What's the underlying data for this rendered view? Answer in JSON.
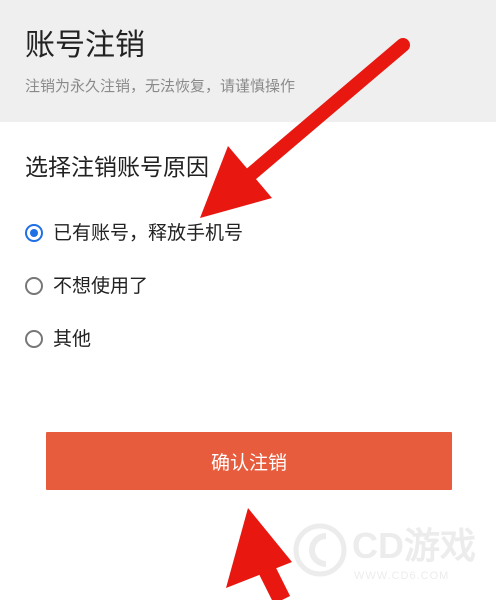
{
  "header": {
    "title": "账号注销",
    "subtitle": "注销为永久注销，无法恢复，请谨慎操作"
  },
  "form": {
    "section_title": "选择注销账号原因",
    "selected_index": 0,
    "options": [
      {
        "label": "已有账号，释放手机号",
        "checked": true
      },
      {
        "label": "不想使用了",
        "checked": false
      },
      {
        "label": "其他",
        "checked": false
      }
    ]
  },
  "actions": {
    "confirm_label": "确认注销"
  },
  "watermark": {
    "brand": "CD游戏",
    "url": "WWW.CD6.COM"
  },
  "colors": {
    "accent_blue": "#1f6fe5",
    "button_red": "#e85c3e",
    "arrow_red": "#e8170f",
    "header_bg": "#efefef"
  },
  "annotations": {
    "arrows": [
      "arrow-pointing-to-first-option",
      "arrow-pointing-to-confirm-button"
    ]
  }
}
